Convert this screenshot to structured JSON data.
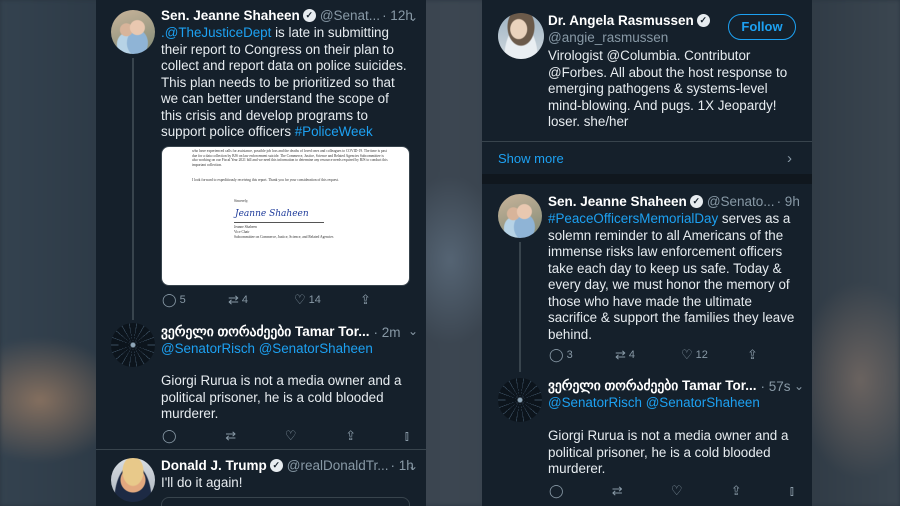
{
  "left": {
    "tweet1": {
      "name": "Sen. Jeanne Shaheen",
      "handle": "@Senat...",
      "time": "· 12h",
      "mention": ".@TheJusticeDept",
      "text": " is late in submitting their report to Congress on their plan to collect and report data on police suicides. This plan needs to be prioritized so that we can better understand the scope of this crisis and develop programs to support police officers ",
      "hashtag": "#PoliceWeek",
      "media": {
        "paragraph1": "who have experienced calls for assistance, possible job loss and the deaths of loved ones and colleagues to COVID-19. The time is past due for a data collection by BJS on law enforcement suicide. The Commerce, Justice, Science and Related Agencies Subcommittee is also working on our Fiscal Year 2021 bill and we need this information to determine any resource needs required by BJS to conduct this important collection.",
        "paragraph2": "I look forward to expeditiously receiving this report. Thank you for your consideration of this request.",
        "closing": "Sincerely,",
        "signature": "Jeanne Shaheen",
        "signer_name": "Jeanne Shaheen",
        "signer_title": "Vice Chair",
        "signer_org": "Subcommittee on Commerce, Justice, Science, and Related Agencies"
      },
      "replies": "5",
      "retweets": "4",
      "likes": "14"
    },
    "tweet2": {
      "name": "ვერელი თორაძეები Tamar Tor...",
      "time": "· 2m",
      "mentions": "@SenatorRisch @SenatorShaheen",
      "text": "Giorgi Rurua is not a media owner and a political prisoner, he is a cold blooded murderer."
    },
    "tweet3": {
      "name": "Donald J. Trump",
      "handle": "@realDonaldTr...",
      "time": "· 1h",
      "text": "I'll do it again!"
    }
  },
  "right": {
    "profile": {
      "name": "Dr. Angela Rasmussen",
      "handle": "@angie_rasmussen",
      "follow_label": "Follow",
      "bio": "Virologist @Columbia. Contributor @Forbes. All about the host response to emerging pathogens & systems-level mind-blowing. And pugs. 1X Jeopardy! loser. she/her",
      "show_more": "Show more"
    },
    "tweet1": {
      "name": "Sen. Jeanne Shaheen",
      "handle": "@Senato...",
      "time": "· 9h",
      "hashtag": "#PeaceOfficersMemorialDay",
      "text": " serves as a solemn reminder to all Americans of the immense risks law enforcement officers take each day to keep us safe. Today & every day, we must honor the memory of those who have made the ultimate sacrifice & support the families they leave behind.",
      "replies": "3",
      "retweets": "4",
      "likes": "12"
    },
    "tweet2": {
      "name": "ვერელი თორაძეები Tamar Tor...",
      "time": "· 57s",
      "mentions": "@SenatorRisch @SenatorShaheen",
      "text": "Giorgi Rurua is not a media owner and a political prisoner, he is a cold blooded murderer."
    }
  },
  "icons": {
    "verified": "✓",
    "chevron": "⌄",
    "reply": "◯",
    "retweet": "⇄",
    "like": "♡",
    "share": "⇪",
    "stats": "⫾",
    "chevron_right": "›"
  },
  "colors": {
    "background": "#15202b",
    "accent": "#1da1f2",
    "muted": "#8899a6"
  }
}
